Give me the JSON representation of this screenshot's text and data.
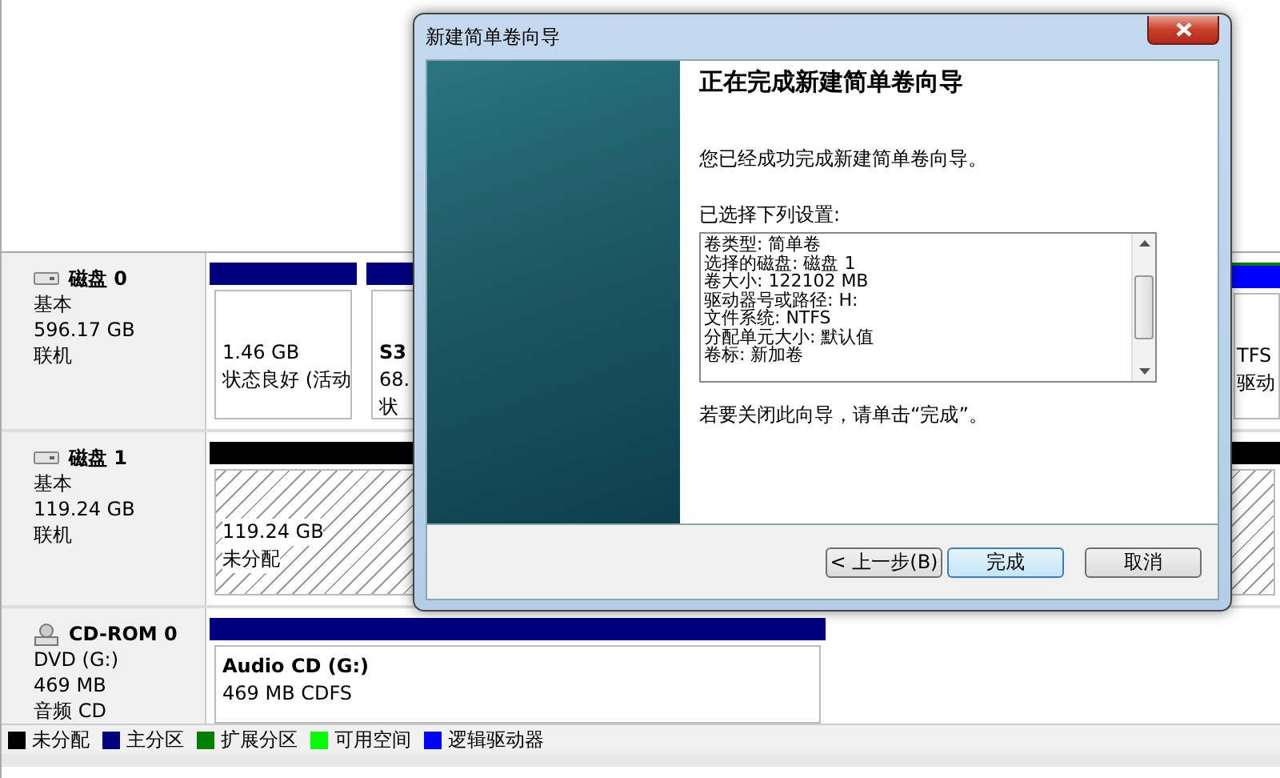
{
  "disks": [
    {
      "kind": "hdd",
      "name": "磁盘 0",
      "type": "基本",
      "size": "596.17 GB",
      "status": "联机",
      "partitions": [
        {
          "kind": "primary",
          "lines": [
            "1.46 GB",
            "状态良好 (活动"
          ]
        },
        {
          "kind": "primary",
          "title": "S3",
          "lines": [
            "68.",
            "状"
          ]
        },
        {
          "kind": "logical",
          "lines": [
            "TFS",
            "驱动"
          ]
        }
      ]
    },
    {
      "kind": "hdd",
      "name": "磁盘 1",
      "type": "基本",
      "size": "119.24 GB",
      "status": "联机",
      "partitions": [
        {
          "kind": "unallocated",
          "lines": [
            "119.24 GB",
            "未分配"
          ]
        }
      ]
    },
    {
      "kind": "cdrom",
      "name": "CD-ROM 0",
      "type": "DVD (G:)",
      "size": "469 MB",
      "status": "音频 CD",
      "partitions": [
        {
          "kind": "primary",
          "title": "Audio CD  (G:)",
          "lines": [
            "469 MB CDFS"
          ]
        }
      ]
    }
  ],
  "legend": [
    {
      "label": "未分配",
      "color": "#000000"
    },
    {
      "label": "主分区",
      "color": "#00007f"
    },
    {
      "label": "扩展分区",
      "color": "#007f00"
    },
    {
      "label": "可用空间",
      "color": "#00ff00"
    },
    {
      "label": "逻辑驱动器",
      "color": "#0000ff"
    }
  ],
  "dialog": {
    "title": "新建简单卷向导",
    "heading": "正在完成新建简单卷向导",
    "intro": "您已经成功完成新建简单卷向导。",
    "settings_label": "已选择下列设置:",
    "settings": [
      "卷类型: 简单卷",
      "选择的磁盘: 磁盘 1",
      "卷大小: 122102 MB",
      "驱动器号或路径: H:",
      "文件系统: NTFS",
      "分配单元大小: 默认值",
      "卷标: 新加卷"
    ],
    "closing": "若要关闭此向导，请单击“完成”。",
    "buttons": [
      {
        "label": "< 上一步(B)",
        "selected": false
      },
      {
        "label": "完成",
        "selected": true
      },
      {
        "label": "取消",
        "selected": false
      }
    ]
  }
}
